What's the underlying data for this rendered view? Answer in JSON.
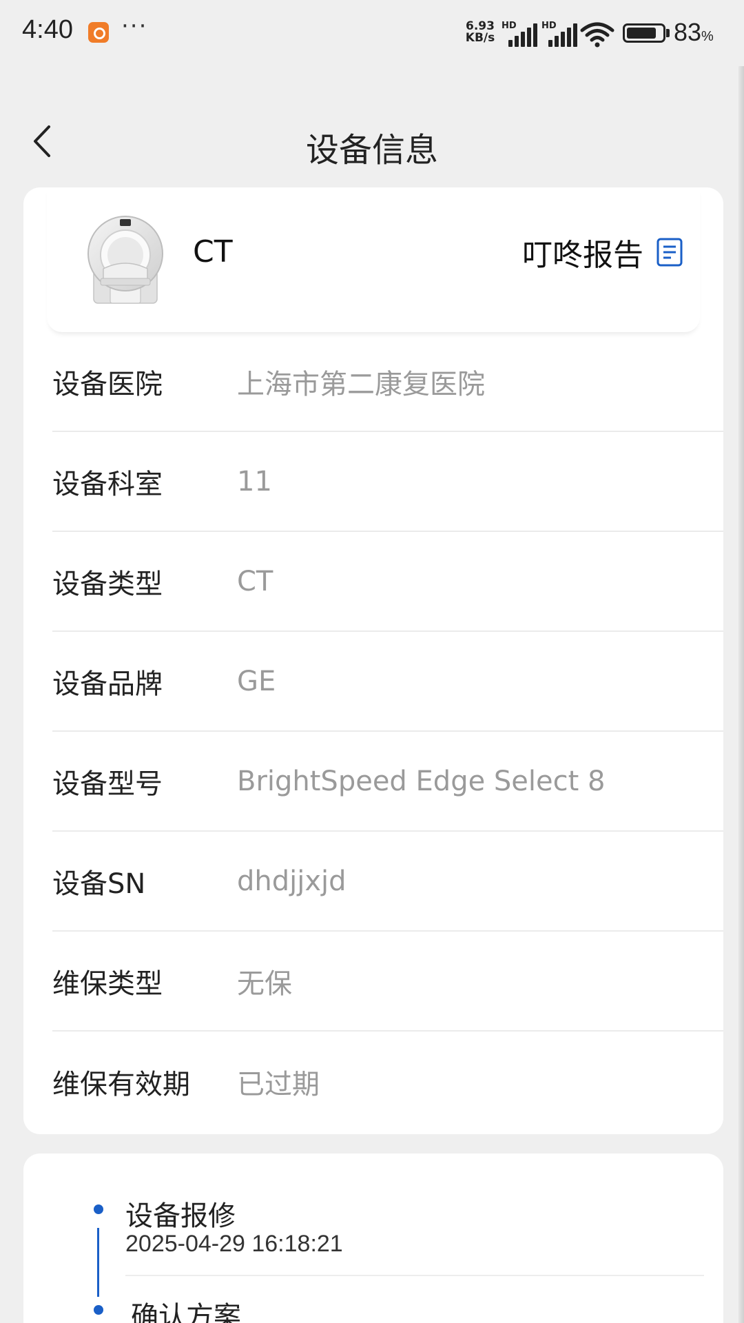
{
  "status_bar": {
    "time": "4:40",
    "more": "···",
    "net_speed_value": "6.93",
    "net_speed_unit": "KB/s",
    "sim1_label": "HD",
    "sim2_label": "HD",
    "battery_level": 0.83,
    "battery_pct": "83",
    "battery_pct_sign": "%"
  },
  "nav": {
    "title": "设备信息"
  },
  "device": {
    "name": "CT",
    "report_label": "叮咚报告"
  },
  "details": [
    {
      "label": "设备医院",
      "value": "上海市第二康复医院"
    },
    {
      "label": "设备科室",
      "value": "11"
    },
    {
      "label": "设备类型",
      "value": "CT"
    },
    {
      "label": "设备品牌",
      "value": "GE"
    },
    {
      "label": "设备型号",
      "value": "BrightSpeed Edge Select 8"
    },
    {
      "label": "设备SN",
      "value": "dhdjjxjd"
    },
    {
      "label": "维保类型",
      "value": "无保"
    },
    {
      "label": "维保有效期",
      "value": "已过期"
    }
  ],
  "timeline": [
    {
      "title": "设备报修",
      "time": "2025-04-29 16:18:21"
    },
    {
      "title": "确认方案"
    }
  ],
  "colors": {
    "accent": "#1a5fc7",
    "background": "#efefef",
    "card": "#ffffff",
    "value_text": "#9a9a9a"
  },
  "icons": {
    "back": "chevron-left-icon",
    "report": "document-icon"
  }
}
